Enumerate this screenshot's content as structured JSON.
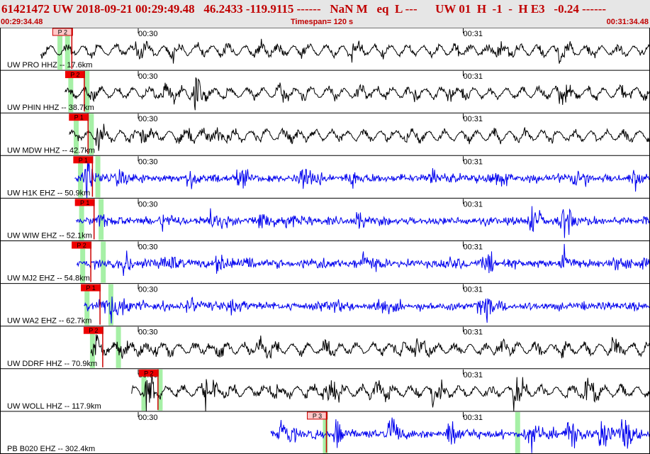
{
  "header": {
    "title": "61421472 UW 2018-09-21 00:29:49.48   46.2433 -119.9115 ------   NaN M   eq  L ---      UW 01  H  -1  -  H E3   -0.24 ------",
    "start_time": "00:29:34.48",
    "timespan": "Timespan= 120 s",
    "end_time": "00:31:34.48"
  },
  "colors": {
    "title": "#c00000",
    "header_bg": "#e6e6e6",
    "trace_hhz": "#000000",
    "trace_ehz": "#0000ee",
    "pick_marker": "#ee0000",
    "pick_marker_alt": "#ffc8c8",
    "pick_line": "#cc0000",
    "phase_window": "#a6f0a6",
    "separator": "#000000"
  },
  "panels": [
    {
      "label": "UW PRO HHZ -- 17.6km",
      "color": "black",
      "t_start": 7.5,
      "pick": {
        "text": "P 2",
        "t": 11.3,
        "style": "alt"
      },
      "greens": [
        11.0,
        12.4
      ],
      "bursts": [
        [
          25,
          10
        ],
        [
          32,
          6
        ],
        [
          48,
          8
        ],
        [
          65,
          7
        ],
        [
          84,
          10
        ],
        [
          92,
          12
        ],
        [
          103,
          10
        ]
      ]
    },
    {
      "label": "UW PHIN HHZ -- 38.7km",
      "color": "black",
      "t_start": 12.0,
      "pick": {
        "text": "P 2",
        "t": 13.6,
        "style": "red"
      },
      "greens": [
        13.0,
        16.0
      ],
      "bursts": [
        [
          16,
          8
        ],
        [
          30,
          14
        ],
        [
          36,
          22
        ],
        [
          52,
          6
        ],
        [
          67,
          6
        ],
        [
          75,
          8
        ],
        [
          83,
          10
        ],
        [
          103,
          14
        ],
        [
          115,
          8
        ]
      ]
    },
    {
      "label": "UW MDW HHZ -- 42.7km",
      "color": "black",
      "t_start": 12.8,
      "pick": {
        "text": "P 1",
        "t": 14.3,
        "style": "red"
      },
      "greens": [
        14.0,
        16.8
      ],
      "bursts": [
        [
          18,
          10
        ],
        [
          26,
          10
        ],
        [
          35,
          8
        ],
        [
          40,
          14
        ],
        [
          54,
          6
        ],
        [
          75,
          6
        ]
      ]
    },
    {
      "label": "UW H1K EHZ -- 50.9km",
      "color": "blue",
      "t_start": 13.8,
      "pick": {
        "text": "P 1",
        "t": 15.1,
        "style": "red"
      },
      "greens": [
        14.8,
        18.0
      ],
      "bursts": [
        [
          16,
          24
        ],
        [
          22,
          10
        ],
        [
          35,
          14
        ],
        [
          44,
          10
        ],
        [
          56,
          16
        ],
        [
          65,
          10
        ],
        [
          80,
          12
        ],
        [
          91,
          12
        ],
        [
          106,
          14
        ],
        [
          117,
          16
        ]
      ]
    },
    {
      "label": "UW WIW EHZ -- 52.1km",
      "color": "blue",
      "t_start": 14.0,
      "pick": {
        "text": "P 1",
        "t": 15.4,
        "style": "red"
      },
      "greens": [
        15.0,
        18.6
      ],
      "bursts": [
        [
          18,
          10
        ],
        [
          30,
          10
        ],
        [
          39,
          14
        ],
        [
          48,
          14
        ],
        [
          52,
          12
        ],
        [
          66,
          8
        ],
        [
          98,
          18
        ],
        [
          104,
          22
        ]
      ]
    },
    {
      "label": "UW MJ2 EHZ -- 54.8km",
      "color": "blue",
      "t_start": 14.2,
      "pick": {
        "text": "P 2",
        "t": 14.8,
        "style": "red"
      },
      "greens": [
        15.2,
        19.0
      ],
      "bursts": [
        [
          23,
          16
        ],
        [
          30,
          18
        ],
        [
          40,
          16
        ],
        [
          45,
          12
        ],
        [
          58,
          10
        ],
        [
          67,
          14
        ],
        [
          82,
          10
        ],
        [
          90,
          14
        ],
        [
          104,
          16
        ],
        [
          114,
          12
        ]
      ]
    },
    {
      "label": "UW WA2 EHZ -- 62.7km",
      "color": "blue",
      "t_start": 15.5,
      "pick": {
        "text": "P 1",
        "t": 16.5,
        "style": "red"
      },
      "greens": [
        16.0,
        20.4
      ],
      "bursts": [
        [
          18,
          12
        ],
        [
          20,
          14
        ],
        [
          22,
          10
        ],
        [
          25,
          6
        ],
        [
          35,
          8
        ],
        [
          42,
          8
        ],
        [
          61,
          8
        ],
        [
          70,
          12
        ],
        [
          89,
          22
        ]
      ]
    },
    {
      "label": "UW DDRF HHZ -- 70.9km",
      "color": "black",
      "t_start": 16.8,
      "pick": {
        "text": "P 2",
        "t": 17.0,
        "style": "red"
      },
      "greens": [
        17.0,
        21.8
      ],
      "bursts": [
        [
          17.5,
          20
        ],
        [
          23,
          12
        ],
        [
          28,
          10
        ],
        [
          39,
          12
        ],
        [
          48,
          14
        ],
        [
          60,
          12
        ],
        [
          73,
          12
        ],
        [
          77,
          14
        ],
        [
          92,
          12
        ],
        [
          103,
          12
        ],
        [
          113,
          12
        ]
      ]
    },
    {
      "label": "UW WOLL HHZ -- 117.9km",
      "color": "black",
      "t_start": 24.3,
      "pick": {
        "text": "P 2",
        "t": 27.2,
        "style": "red"
      },
      "greens": [
        26.5,
        29.5
      ],
      "bursts": [
        [
          27,
          22
        ],
        [
          38,
          22
        ],
        [
          50,
          18
        ],
        [
          60,
          20
        ],
        [
          69,
          18
        ],
        [
          80,
          20
        ],
        [
          95,
          20
        ],
        [
          108,
          18
        ]
      ]
    },
    {
      "label": "PB B020 EHZ -- 302.4km",
      "color": "blue",
      "t_start": 50.0,
      "pick": {
        "text": "P 3",
        "t": 58.3,
        "style": "alt"
      },
      "greens": [
        60.0,
        95.5
      ],
      "bursts": [
        [
          52,
          20
        ],
        [
          62,
          20
        ],
        [
          72,
          22
        ],
        [
          83,
          20
        ],
        [
          98,
          22
        ],
        [
          105,
          26
        ],
        [
          111,
          28
        ],
        [
          115,
          22
        ]
      ]
    }
  ],
  "minute_marks": [
    "00:30",
    "00:31"
  ],
  "scroll": {
    "start_s": 0,
    "span_s": 120
  }
}
